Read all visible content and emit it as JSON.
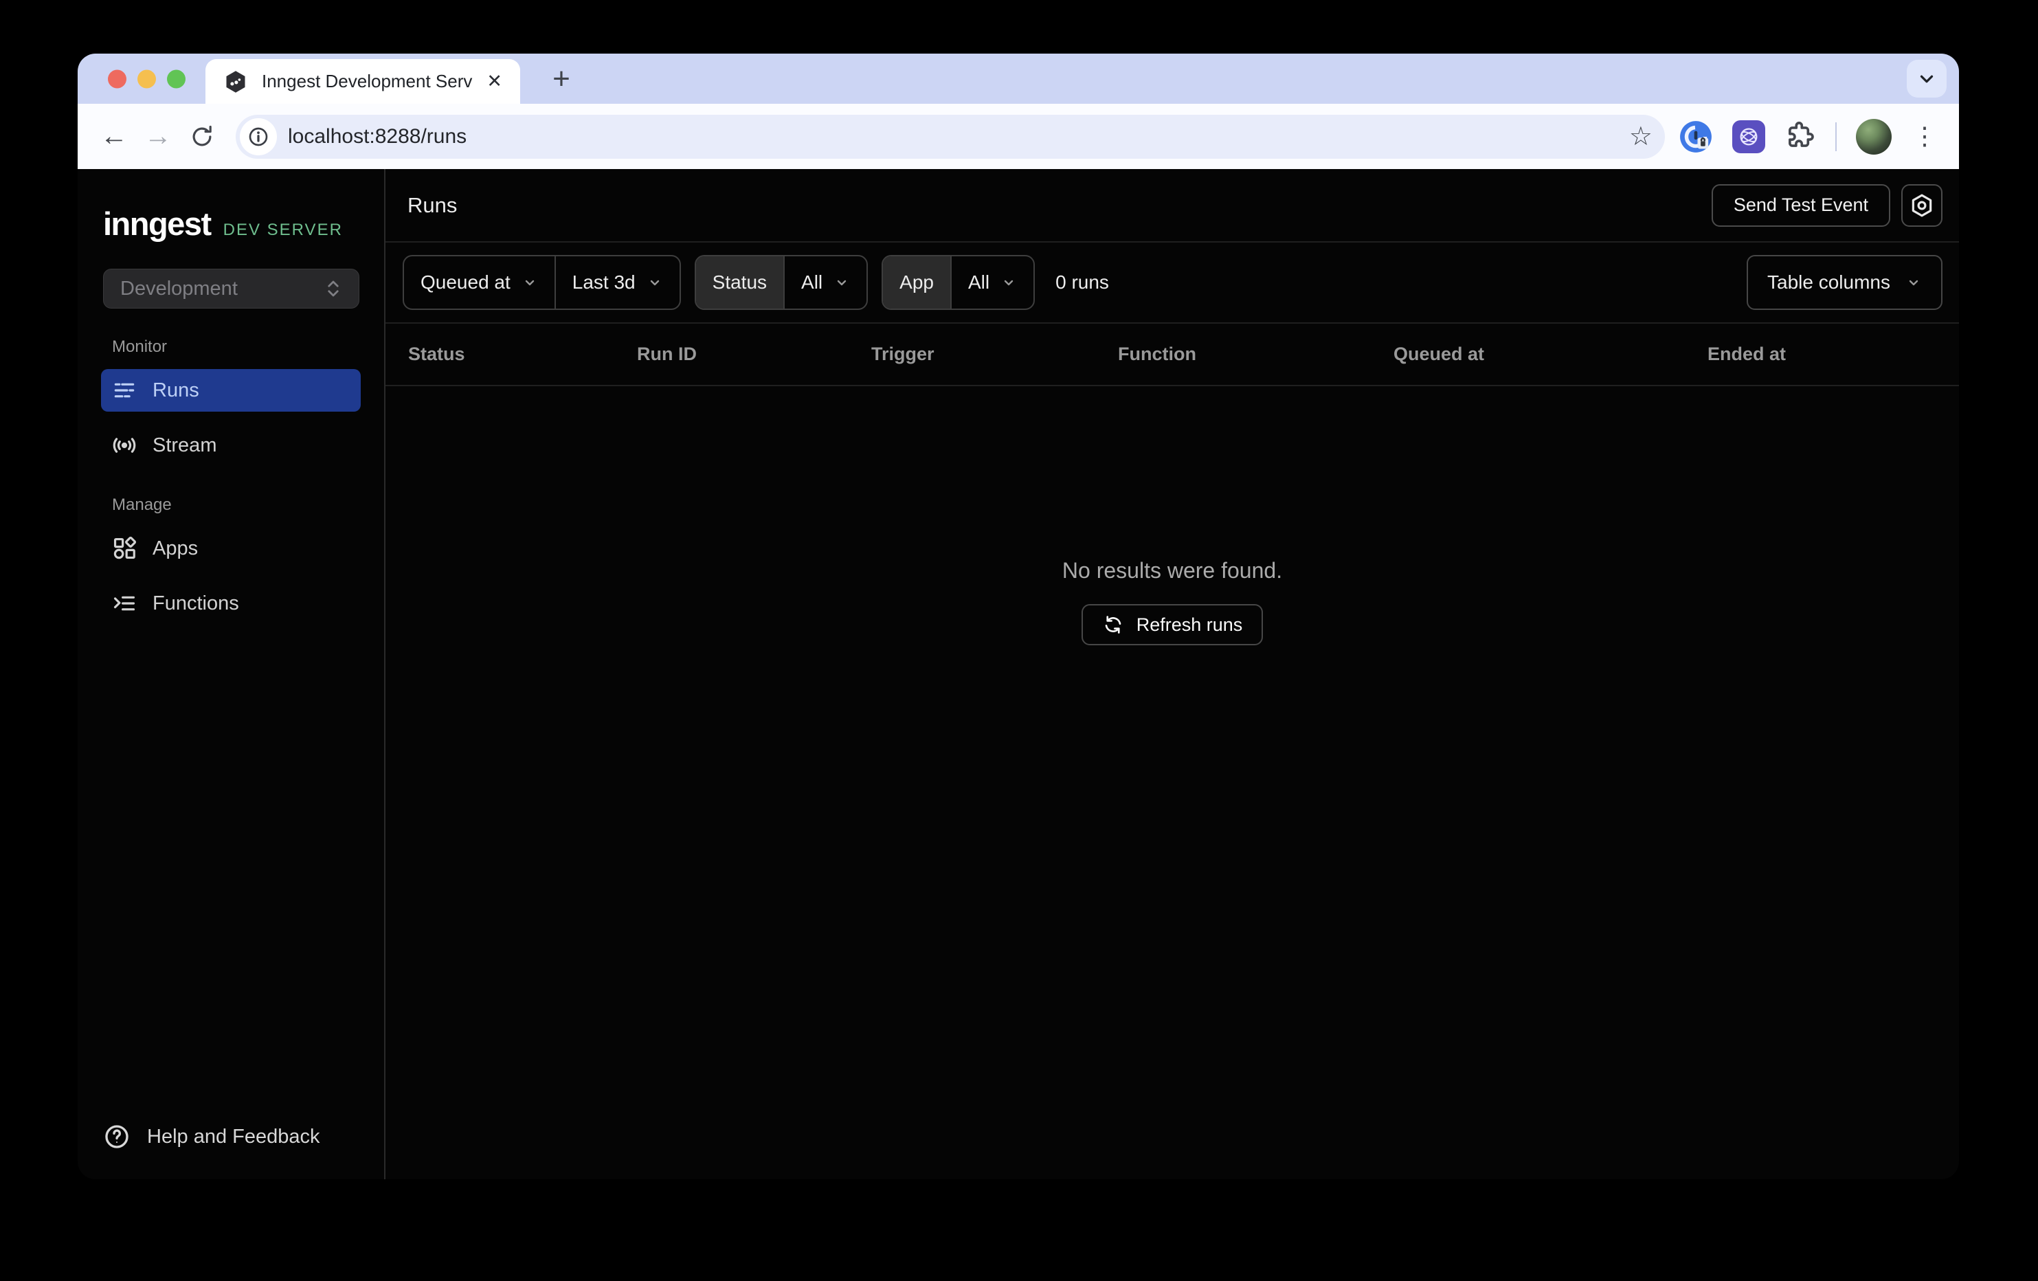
{
  "browser": {
    "tab_title": "Inngest Development Server",
    "url": "localhost:8288/runs",
    "glyphs": {
      "back": "←",
      "forward": "→",
      "plus": "+",
      "close": "✕",
      "star": "☆",
      "kebab": "⋮",
      "help": "?"
    }
  },
  "sidebar": {
    "logo_text": "inngest",
    "logo_badge": "DEV SERVER",
    "environment": "Development",
    "sections": [
      {
        "label": "Monitor",
        "items": [
          {
            "label": "Runs"
          },
          {
            "label": "Stream"
          }
        ]
      },
      {
        "label": "Manage",
        "items": [
          {
            "label": "Apps"
          },
          {
            "label": "Functions"
          }
        ]
      }
    ],
    "help_label": "Help and Feedback"
  },
  "header": {
    "title": "Runs",
    "send_test_event": "Send Test Event"
  },
  "filters": {
    "field": "Queued at",
    "range": "Last 3d",
    "status_label": "Status",
    "status_value": "All",
    "app_label": "App",
    "app_value": "All",
    "count": "0 runs",
    "table_columns": "Table columns"
  },
  "table": {
    "columns": [
      "Status",
      "Run ID",
      "Trigger",
      "Function",
      "Queued at",
      "Ended at"
    ]
  },
  "empty_state": {
    "message": "No results were found.",
    "refresh_label": "Refresh runs"
  },
  "colors": {
    "active_nav_bg": "#1f3a8f",
    "active_nav_text": "#bdd0f6",
    "brand_green": "#6fbe8e",
    "tabstrip_lavender": "#ccd5f4",
    "omnibox_fill": "#e8ecfa",
    "app_background": "#050505",
    "traffic_red": "#ee6a5f",
    "traffic_yellow": "#f5bf4f",
    "traffic_green": "#61c455",
    "onepassword_blue": "#3f79e6",
    "extension_purple": "#5a4fc0"
  }
}
